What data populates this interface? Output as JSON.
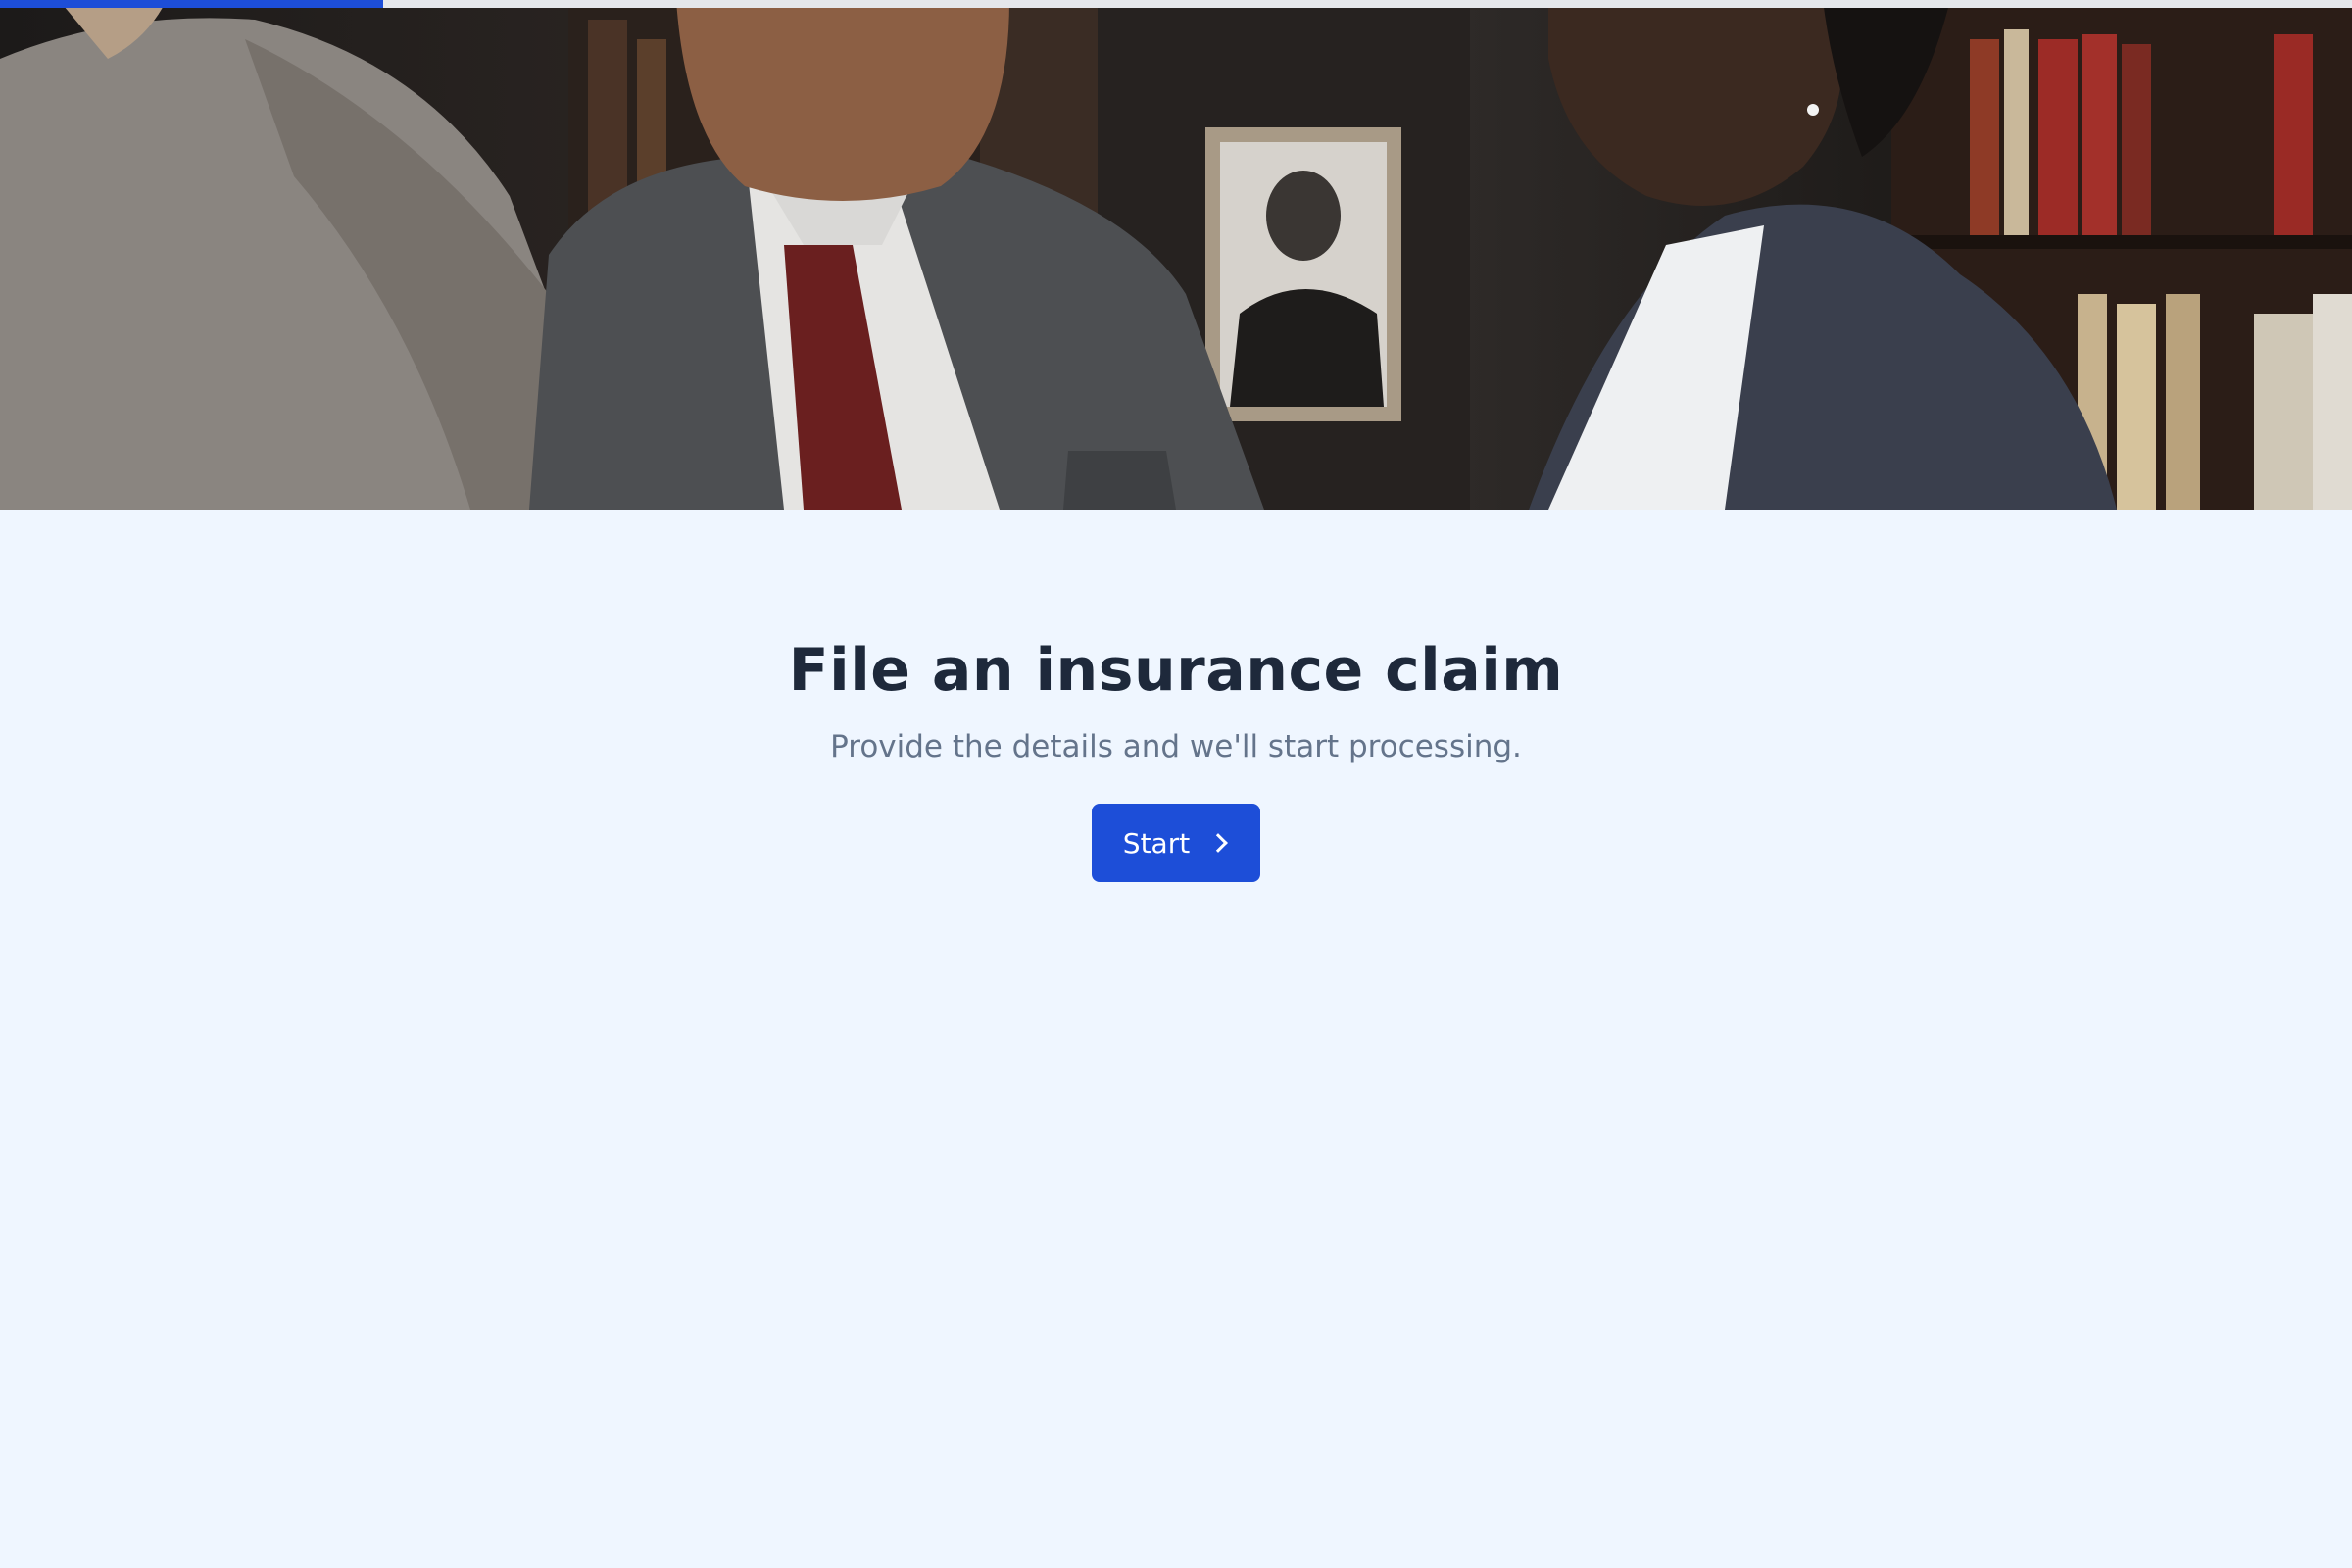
{
  "progress": {
    "fraction": 0.163,
    "color": "#1d4ed8"
  },
  "hero": {
    "icon": "office-meeting-photo"
  },
  "main": {
    "title": "File an insurance claim",
    "subtitle": "Provide the details and we'll start processing.",
    "start_button": {
      "label": "Start",
      "icon": "chevron-right-icon",
      "color": "#1d4ed8"
    }
  },
  "colors": {
    "background": "#eff6ff",
    "title": "#1e293b",
    "subtitle": "#64748b"
  }
}
